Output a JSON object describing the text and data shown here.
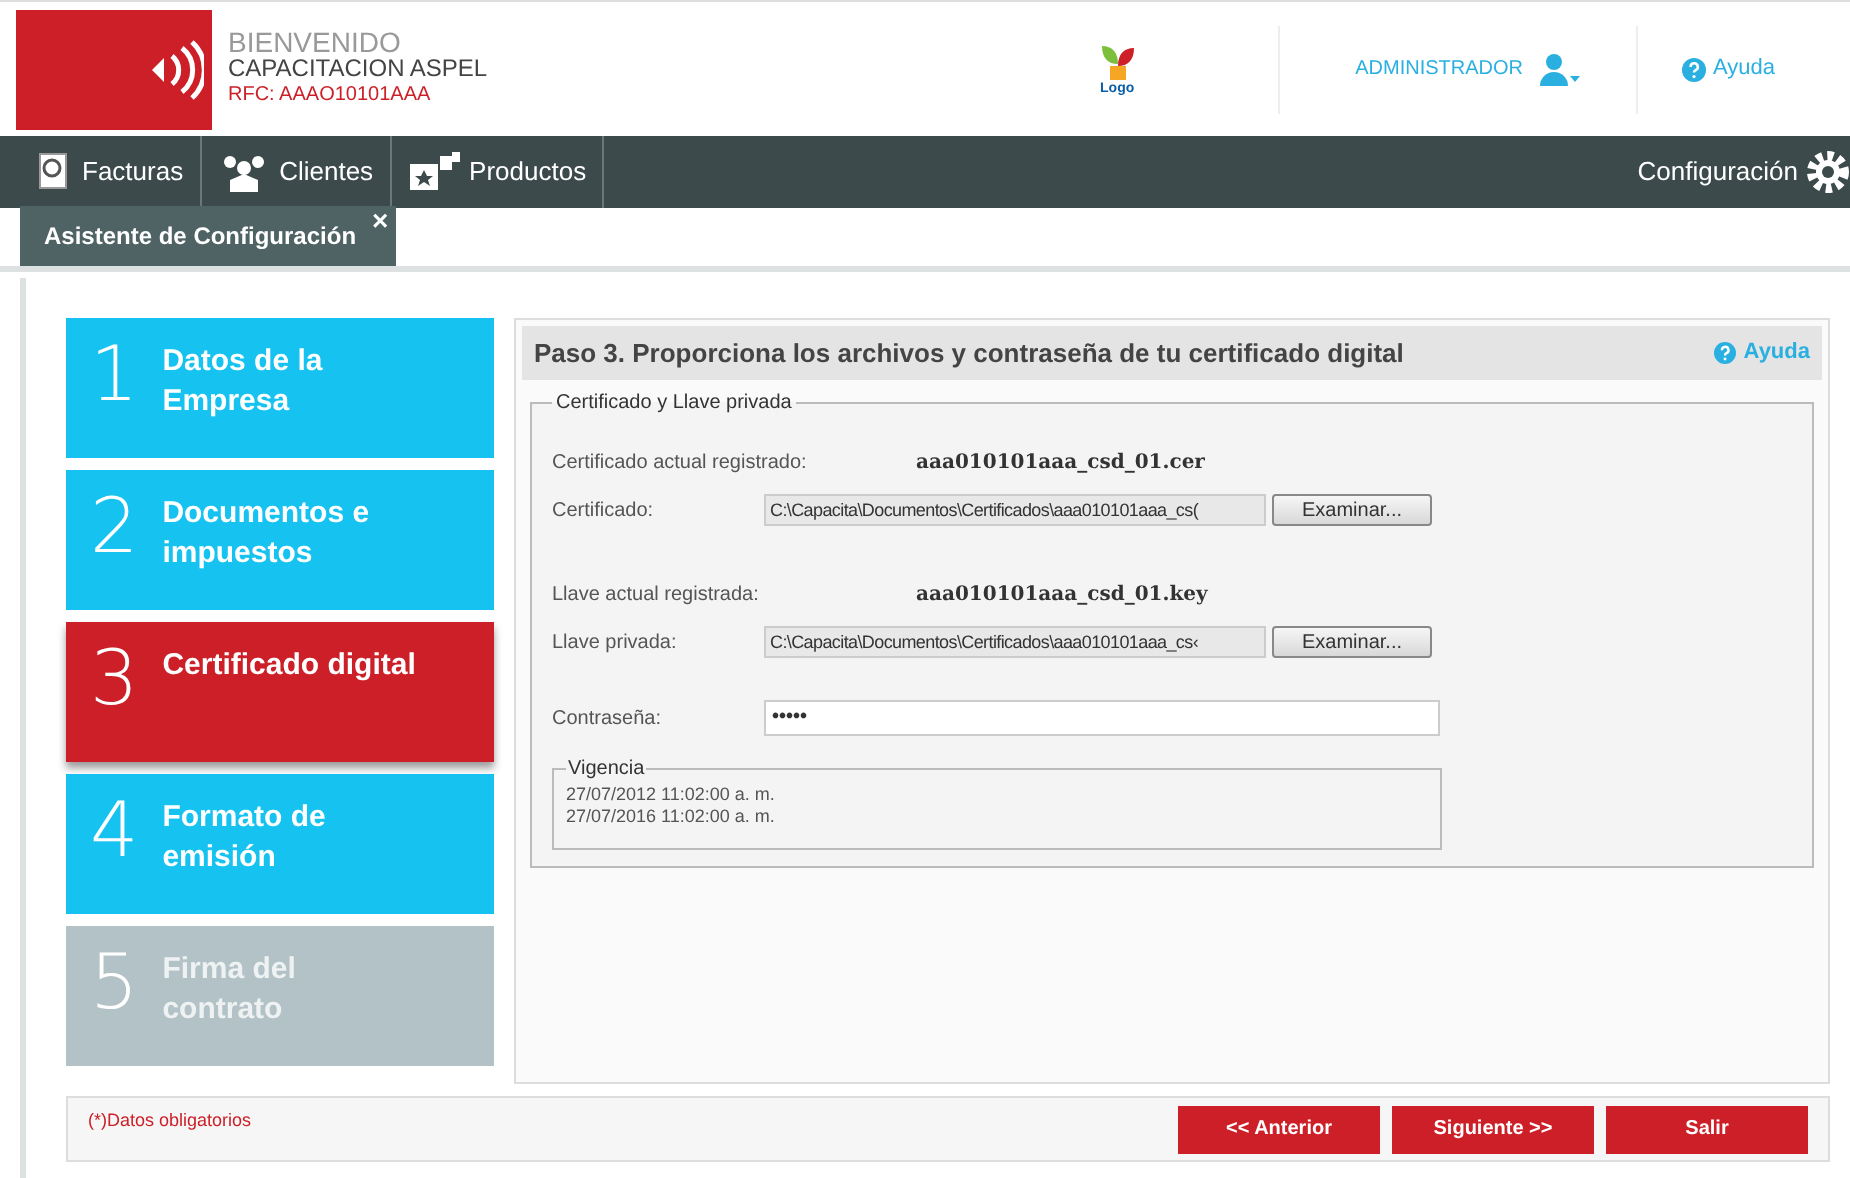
{
  "header": {
    "welcome": "BIENVENIDO",
    "company": "CAPACITACION ASPEL",
    "rfc": "RFC: AAAO10101AAA",
    "logo_text": "Logo",
    "user": "ADMINISTRADOR",
    "help": "Ayuda"
  },
  "nav": {
    "items": [
      {
        "label": "Facturas",
        "kind": "invoice"
      },
      {
        "label": "Clientes",
        "kind": "clients"
      },
      {
        "label": "Productos",
        "kind": "products"
      }
    ],
    "settings": "Configuración"
  },
  "tabs": [
    {
      "label": "Asistente de Configuración",
      "selected": true,
      "close": "×"
    }
  ],
  "steps": [
    {
      "number": "1",
      "label": "Datos de la Empresa",
      "selected": false,
      "disabled": false
    },
    {
      "number": "2",
      "label": "Documentos e impuestos",
      "selected": false,
      "disabled": false
    },
    {
      "number": "3",
      "label": "Certificado digital",
      "selected": true,
      "disabled": false
    },
    {
      "number": "4",
      "label": "Formato de emisión",
      "selected": false,
      "disabled": false
    },
    {
      "number": "5",
      "label": "Firma del contrato",
      "selected": false,
      "disabled": true
    }
  ],
  "panel": {
    "title": "Paso 3. Proporciona los archivos y contraseña de tu certificado digital",
    "help": "Ayuda",
    "group": "Certificado y Llave privada",
    "rows": [
      {
        "kind": "info",
        "label": "Certificado actual registrado:",
        "value": "aaa010101aaa_csd_01.cer"
      },
      {
        "kind": "file",
        "label": "Certificado:",
        "value": "C:\\Capacita\\Documentos\\Certificados\\aaa010101aaa_cs(",
        "button": "Examinar..."
      },
      {
        "kind": "info",
        "label": "Llave actual registrada:",
        "value": "aaa010101aaa_csd_01.key"
      },
      {
        "kind": "file",
        "label": "Llave privada:",
        "value": "C:\\Capacita\\Documentos\\Certificados\\aaa010101aaa_cs‹",
        "button": "Examinar..."
      },
      {
        "kind": "password",
        "label": "Contraseña:",
        "value": "•••••"
      }
    ],
    "validity": {
      "title": "Vigencia",
      "dates": [
        "27/07/2012 11:02:00 a. m.",
        "27/07/2016 11:02:00 a. m."
      ]
    }
  },
  "footer": {
    "note": "(*)Datos obligatorios",
    "buttons": [
      "<< Anterior",
      "Siguiente >>",
      "Salir"
    ]
  }
}
